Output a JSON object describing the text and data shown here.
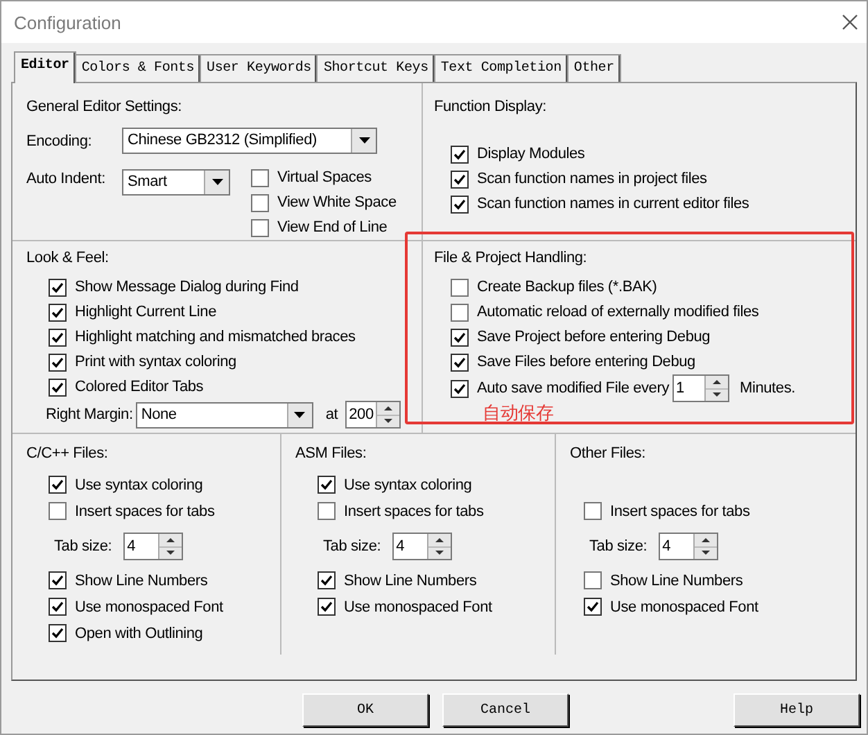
{
  "window": {
    "title": "Configuration"
  },
  "tabs": [
    {
      "label": "Editor",
      "selected": true
    },
    {
      "label": "Colors & Fonts",
      "selected": false
    },
    {
      "label": "User Keywords",
      "selected": false
    },
    {
      "label": "Shortcut Keys",
      "selected": false
    },
    {
      "label": "Text Completion",
      "selected": false
    },
    {
      "label": "Other",
      "selected": false
    }
  ],
  "general": {
    "heading": "General Editor Settings:",
    "encoding": {
      "label": "Encoding:",
      "value": "Chinese GB2312 (Simplified)"
    },
    "auto_indent": {
      "label": "Auto Indent:",
      "value": "Smart"
    },
    "options": [
      {
        "label": "Virtual Spaces",
        "checked": false
      },
      {
        "label": "View White Space",
        "checked": false
      },
      {
        "label": "View End of Line",
        "checked": false
      }
    ]
  },
  "function_display": {
    "heading": "Function Display:",
    "options": [
      {
        "label": "Display Modules",
        "checked": true
      },
      {
        "label": "Scan function names in project files",
        "checked": true
      },
      {
        "label": "Scan function names in current editor files",
        "checked": true
      }
    ]
  },
  "look_and_feel": {
    "heading": "Look & Feel:",
    "options": [
      {
        "label": "Show Message Dialog during Find",
        "checked": true
      },
      {
        "label": "Highlight Current Line",
        "checked": true
      },
      {
        "label": "Highlight matching and mismatched braces",
        "checked": true
      },
      {
        "label": "Print with syntax coloring",
        "checked": true
      },
      {
        "label": "Colored Editor Tabs",
        "checked": true
      }
    ],
    "right_margin": {
      "label": "Right Margin:",
      "value": "None",
      "at_label": "at",
      "at_value": "200"
    }
  },
  "file_handling": {
    "heading": "File & Project Handling:",
    "options": [
      {
        "kind": "checkbox",
        "label": "Create Backup files (*.BAK)",
        "checked": false
      },
      {
        "kind": "checkbox",
        "label": "Automatic reload of externally modified files",
        "checked": false
      },
      {
        "kind": "checkbox",
        "label": "Save Project before entering Debug",
        "checked": true
      },
      {
        "kind": "checkbox",
        "label": "Save Files before entering Debug",
        "checked": true
      },
      {
        "kind": "checkbox_spin",
        "label": "Auto save modified File every",
        "checked": true,
        "value": "1",
        "suffix": "Minutes."
      }
    ]
  },
  "file_types": [
    {
      "heading": "C/C++ Files:",
      "items": [
        {
          "kind": "checkbox",
          "label": "Use syntax coloring",
          "checked": true
        },
        {
          "kind": "checkbox",
          "label": "Insert spaces for tabs",
          "checked": false
        },
        {
          "kind": "spin",
          "label": "Tab size:",
          "value": "4"
        },
        {
          "kind": "checkbox",
          "label": "Show Line Numbers",
          "checked": true
        },
        {
          "kind": "checkbox",
          "label": "Use monospaced Font",
          "checked": true
        },
        {
          "kind": "checkbox",
          "label": "Open with Outlining",
          "checked": true
        }
      ]
    },
    {
      "heading": "ASM Files:",
      "items": [
        {
          "kind": "checkbox",
          "label": "Use syntax coloring",
          "checked": true
        },
        {
          "kind": "checkbox",
          "label": "Insert spaces for tabs",
          "checked": false
        },
        {
          "kind": "spin",
          "label": "Tab size:",
          "value": "4"
        },
        {
          "kind": "checkbox",
          "label": "Show Line Numbers",
          "checked": true
        },
        {
          "kind": "checkbox",
          "label": "Use monospaced Font",
          "checked": true
        }
      ]
    },
    {
      "heading": "Other Files:",
      "items": [
        {
          "kind": "checkbox",
          "label": "Insert spaces for tabs",
          "checked": false
        },
        {
          "kind": "spin",
          "label": "Tab size:",
          "value": "4"
        },
        {
          "kind": "checkbox",
          "label": "Show Line Numbers",
          "checked": false
        },
        {
          "kind": "checkbox",
          "label": "Use monospaced Font",
          "checked": true
        }
      ]
    }
  ],
  "annotation": {
    "text": "自动保存"
  },
  "buttons": [
    "OK",
    "Cancel",
    "Help"
  ]
}
